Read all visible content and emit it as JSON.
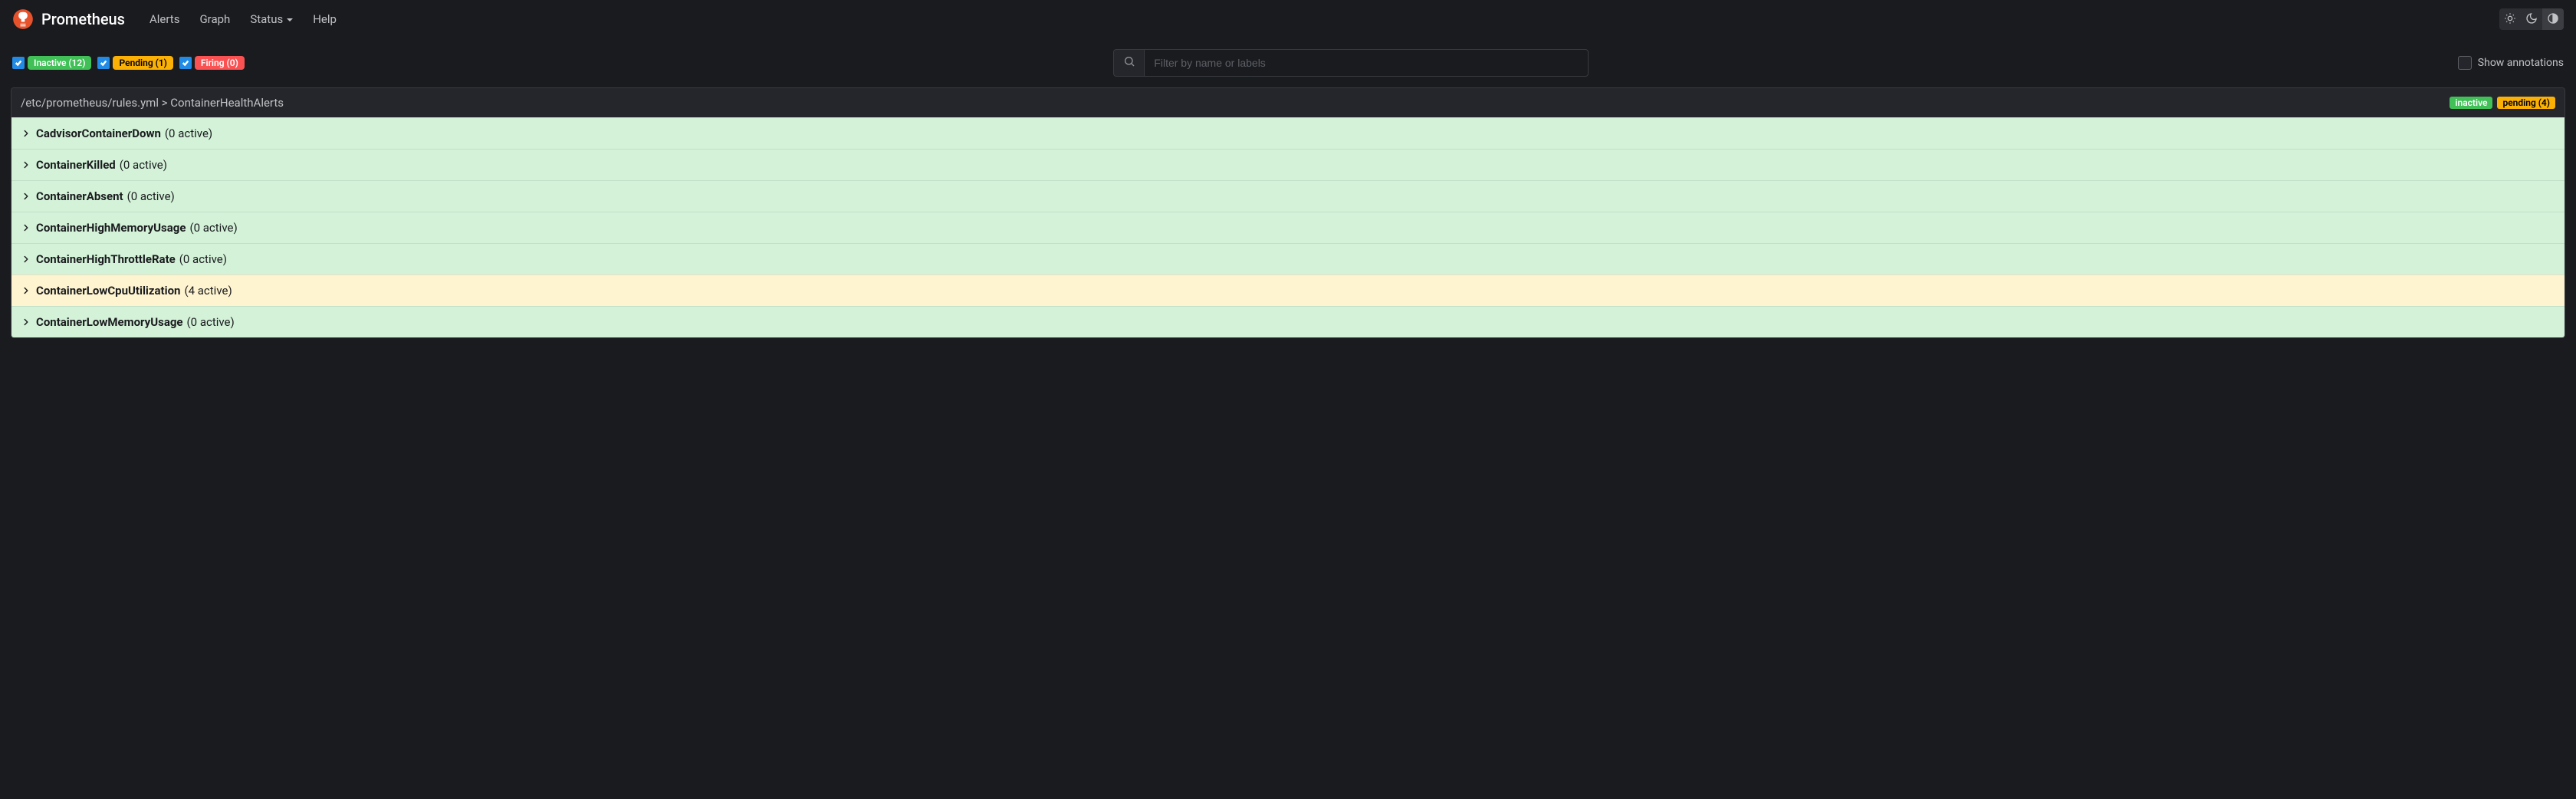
{
  "brand": "Prometheus",
  "nav": {
    "alerts": "Alerts",
    "graph": "Graph",
    "status": "Status",
    "help": "Help"
  },
  "filters": {
    "inactive": "Inactive (12)",
    "pending": "Pending (1)",
    "firing": "Firing (0)"
  },
  "search": {
    "placeholder": "Filter by name or labels"
  },
  "annotations_label": "Show annotations",
  "group": {
    "title": "/etc/prometheus/rules.yml > ContainerHealthAlerts",
    "badges": {
      "inactive": "inactive",
      "pending": "pending (4)"
    }
  },
  "alerts": [
    {
      "name": "CadvisorContainerDown",
      "count": "(0 active)",
      "state": "inactive"
    },
    {
      "name": "ContainerKilled",
      "count": "(0 active)",
      "state": "inactive"
    },
    {
      "name": "ContainerAbsent",
      "count": "(0 active)",
      "state": "inactive"
    },
    {
      "name": "ContainerHighMemoryUsage",
      "count": "(0 active)",
      "state": "inactive"
    },
    {
      "name": "ContainerHighThrottleRate",
      "count": "(0 active)",
      "state": "inactive"
    },
    {
      "name": "ContainerLowCpuUtilization",
      "count": "(4 active)",
      "state": "pending"
    },
    {
      "name": "ContainerLowMemoryUsage",
      "count": "(0 active)",
      "state": "inactive"
    }
  ]
}
